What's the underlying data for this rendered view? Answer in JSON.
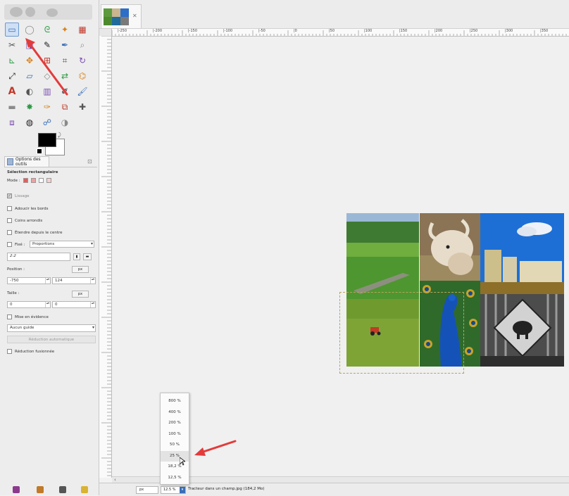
{
  "toolbox": {
    "tools": [
      {
        "name": "rect-select",
        "icon": "rect-select-icon",
        "active": true
      },
      {
        "name": "ellipse-select",
        "icon": "ellipse-select-icon"
      },
      {
        "name": "free-select",
        "icon": "lasso-icon"
      },
      {
        "name": "fuzzy-select",
        "icon": "magic-wand-icon"
      },
      {
        "name": "color-select",
        "icon": "color-select-icon"
      },
      {
        "name": "scissors-select",
        "icon": "scissors-icon"
      },
      {
        "name": "foreground-select",
        "icon": "foreground-select-icon"
      },
      {
        "name": "paths",
        "icon": "paths-icon"
      },
      {
        "name": "color-picker",
        "icon": "eyedropper-icon"
      },
      {
        "name": "zoom",
        "icon": "magnifier-icon"
      },
      {
        "name": "measure",
        "icon": "compass-icon"
      },
      {
        "name": "move",
        "icon": "move-icon"
      },
      {
        "name": "align",
        "icon": "align-icon"
      },
      {
        "name": "crop",
        "icon": "crop-icon"
      },
      {
        "name": "rotate",
        "icon": "rotate-icon"
      },
      {
        "name": "scale",
        "icon": "scale-icon"
      },
      {
        "name": "shear",
        "icon": "shear-icon"
      },
      {
        "name": "perspective",
        "icon": "perspective-icon"
      },
      {
        "name": "flip",
        "icon": "flip-icon"
      },
      {
        "name": "cage",
        "icon": "cage-icon"
      },
      {
        "name": "text",
        "icon": "text-icon"
      },
      {
        "name": "bucket",
        "icon": "bucket-icon"
      },
      {
        "name": "blend",
        "icon": "gradient-icon"
      },
      {
        "name": "pencil",
        "icon": "pencil-icon"
      },
      {
        "name": "paintbrush",
        "icon": "paintbrush-icon"
      },
      {
        "name": "eraser",
        "icon": "eraser-icon"
      },
      {
        "name": "airbrush",
        "icon": "airbrush-icon"
      },
      {
        "name": "ink",
        "icon": "ink-icon"
      },
      {
        "name": "clone",
        "icon": "clone-icon"
      },
      {
        "name": "heal",
        "icon": "heal-icon"
      },
      {
        "name": "perspective-clone",
        "icon": "perspective-clone-icon"
      },
      {
        "name": "blur",
        "icon": "blur-icon"
      },
      {
        "name": "smudge",
        "icon": "smudge-icon"
      },
      {
        "name": "dodge",
        "icon": "dodge-icon"
      }
    ],
    "colors": {
      "foreground": "#000000",
      "background": "#ffffff"
    }
  },
  "tool_options": {
    "tab_label": "Options des outils",
    "title": "Sélection rectangulaire",
    "mode_label": "Mode :",
    "antialias_label": "Lissage",
    "feather_label": "Adoucir les bords",
    "rounded_label": "Coins arrondis",
    "expand_label": "Étendre depuis le centre",
    "fixed_label": "Fixé :",
    "fixed_value": "Proportions",
    "ratio_value": "2:2",
    "position_label": "Position :",
    "position_unit": "px",
    "position_x": "-750",
    "position_y": "124",
    "size_label": "Taille :",
    "size_unit": "px",
    "size_w": "0",
    "size_h": "0",
    "highlight_label": "Mise en évidence",
    "guides_value": "Aucun guide",
    "auto_shrink_label": "Réduction automatique",
    "shrink_merged_label": "Réduction fusionnée"
  },
  "ruler": {
    "labels": [
      "|-250",
      "|-200",
      "|-150",
      "|-100",
      "|-50",
      "|0",
      "|50",
      "|100",
      "|150",
      "|200",
      "|250",
      "|300",
      "|350"
    ]
  },
  "status": {
    "unit": "px",
    "zoom": "12.5 %",
    "text": "Tracteur dans un champ.jpg (184,2 Mo)"
  },
  "zoom_menu": {
    "items": [
      "800 %",
      "400 %",
      "200 %",
      "100 %",
      "50 %",
      "25 %",
      "18,2 %",
      "12,5 %"
    ],
    "hovered_index": 5
  },
  "accent": {
    "selection": "#b6a55a",
    "annotation": "#e33b3b",
    "active_tool": "#cfe0f5"
  }
}
